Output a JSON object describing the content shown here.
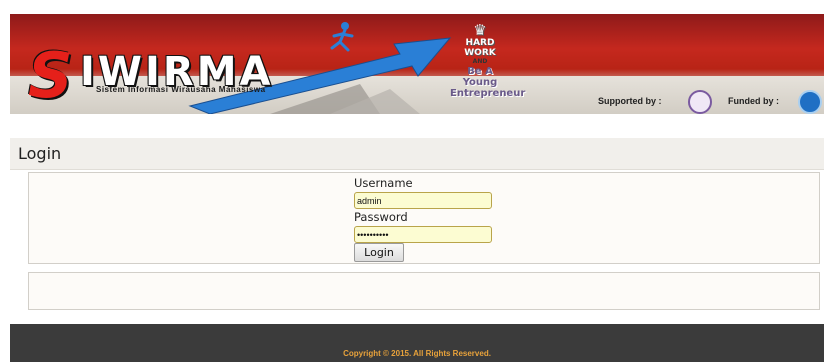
{
  "header": {
    "logo_initial": "S",
    "logo_rest": "IWIRMA",
    "logo_subtitle": "Sistem Informasi Wirausaha Mahasiswa",
    "motto_line1": "HARD",
    "motto_line2": "WORK",
    "motto_line3": "AND",
    "motto_line4": "Be A Young",
    "motto_line5": "Entrepreneur",
    "supported_by": "Supported by :",
    "funded_by": "Funded by :",
    "brand_red": "#c5281e",
    "arrow_blue": "#2a7fd6"
  },
  "login": {
    "heading": "Login",
    "username_label": "Username",
    "username_value": "admin",
    "password_label": "Password",
    "password_value": "••••••••••",
    "submit_label": "Login"
  },
  "footer": {
    "copyright": "Copyright © 2015. All Rights Reserved."
  }
}
